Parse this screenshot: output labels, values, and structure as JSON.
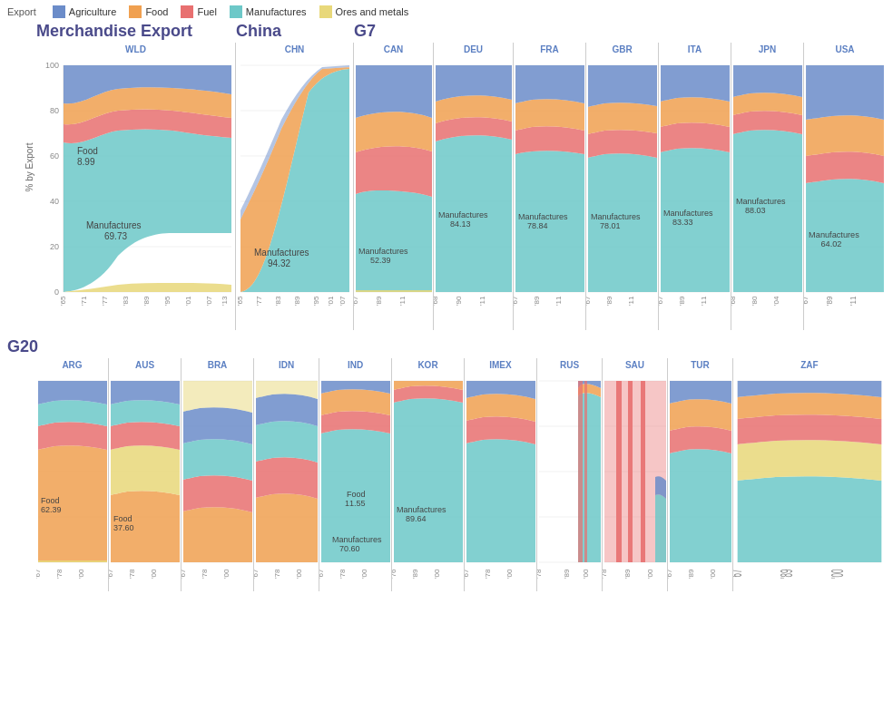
{
  "legend": {
    "title": "Export",
    "items": [
      {
        "label": "Agriculture",
        "color": "#6b8cc9"
      },
      {
        "label": "Food",
        "color": "#f0a050"
      },
      {
        "label": "Fuel",
        "color": "#e87070"
      },
      {
        "label": "Manufactures",
        "color": "#6dc8c8"
      },
      {
        "label": "Ores and metals",
        "color": "#e8d87a"
      }
    ]
  },
  "sections": {
    "merchandise_label": "Merchandise Export",
    "china_label": "China",
    "g7_label": "G7",
    "g20_label": "G20"
  },
  "wld": {
    "code": "WLD",
    "annotations": [
      {
        "label": "Food",
        "value": "8.99"
      },
      {
        "label": "Manufactures",
        "value": "69.73"
      }
    ]
  },
  "chn": {
    "code": "CHN",
    "annotations": [
      {
        "label": "Manufactures",
        "value": "94.32"
      }
    ]
  },
  "g7_panels": [
    {
      "code": "CAN",
      "label": "Manufactures",
      "value": "52.39"
    },
    {
      "code": "DEU",
      "label": "Manufactures",
      "value": "84.13"
    },
    {
      "code": "FRA",
      "label": "Manufactures",
      "value": "78.84"
    },
    {
      "code": "GBR",
      "label": "Manufactures",
      "value": "78.01"
    },
    {
      "code": "ITA",
      "label": "Manufactures",
      "value": "83.33"
    },
    {
      "code": "JPN",
      "label": "Manufactures",
      "value": "88.03"
    },
    {
      "code": "USA",
      "label": "Manufactures",
      "value": "64.02"
    }
  ],
  "g20_panels": [
    {
      "code": "ARG",
      "label": "Food",
      "value": "62.39"
    },
    {
      "code": "AUS",
      "label": "Food",
      "value": "37.60"
    },
    {
      "code": "BRA",
      "label": "",
      "value": ""
    },
    {
      "code": "IDN",
      "label": "",
      "value": ""
    },
    {
      "code": "IND",
      "label": "Food",
      "value": "11.55",
      "label2": "Manufactures",
      "value2": "70.60"
    },
    {
      "code": "KOR",
      "label": "Manufactures",
      "value": "89.64"
    },
    {
      "code": "IMEX",
      "label": "",
      "value": ""
    },
    {
      "code": "RUS",
      "label": "",
      "value": ""
    },
    {
      "code": "SAU",
      "label": "",
      "value": ""
    },
    {
      "code": "TUR",
      "label": "",
      "value": ""
    },
    {
      "code": "ZAF",
      "label": "",
      "value": ""
    }
  ],
  "colors": {
    "agriculture": "#6b8cc9",
    "food": "#f0a050",
    "fuel": "#e87070",
    "manufactures": "#6dc8c8",
    "ores": "#e8d87a"
  }
}
